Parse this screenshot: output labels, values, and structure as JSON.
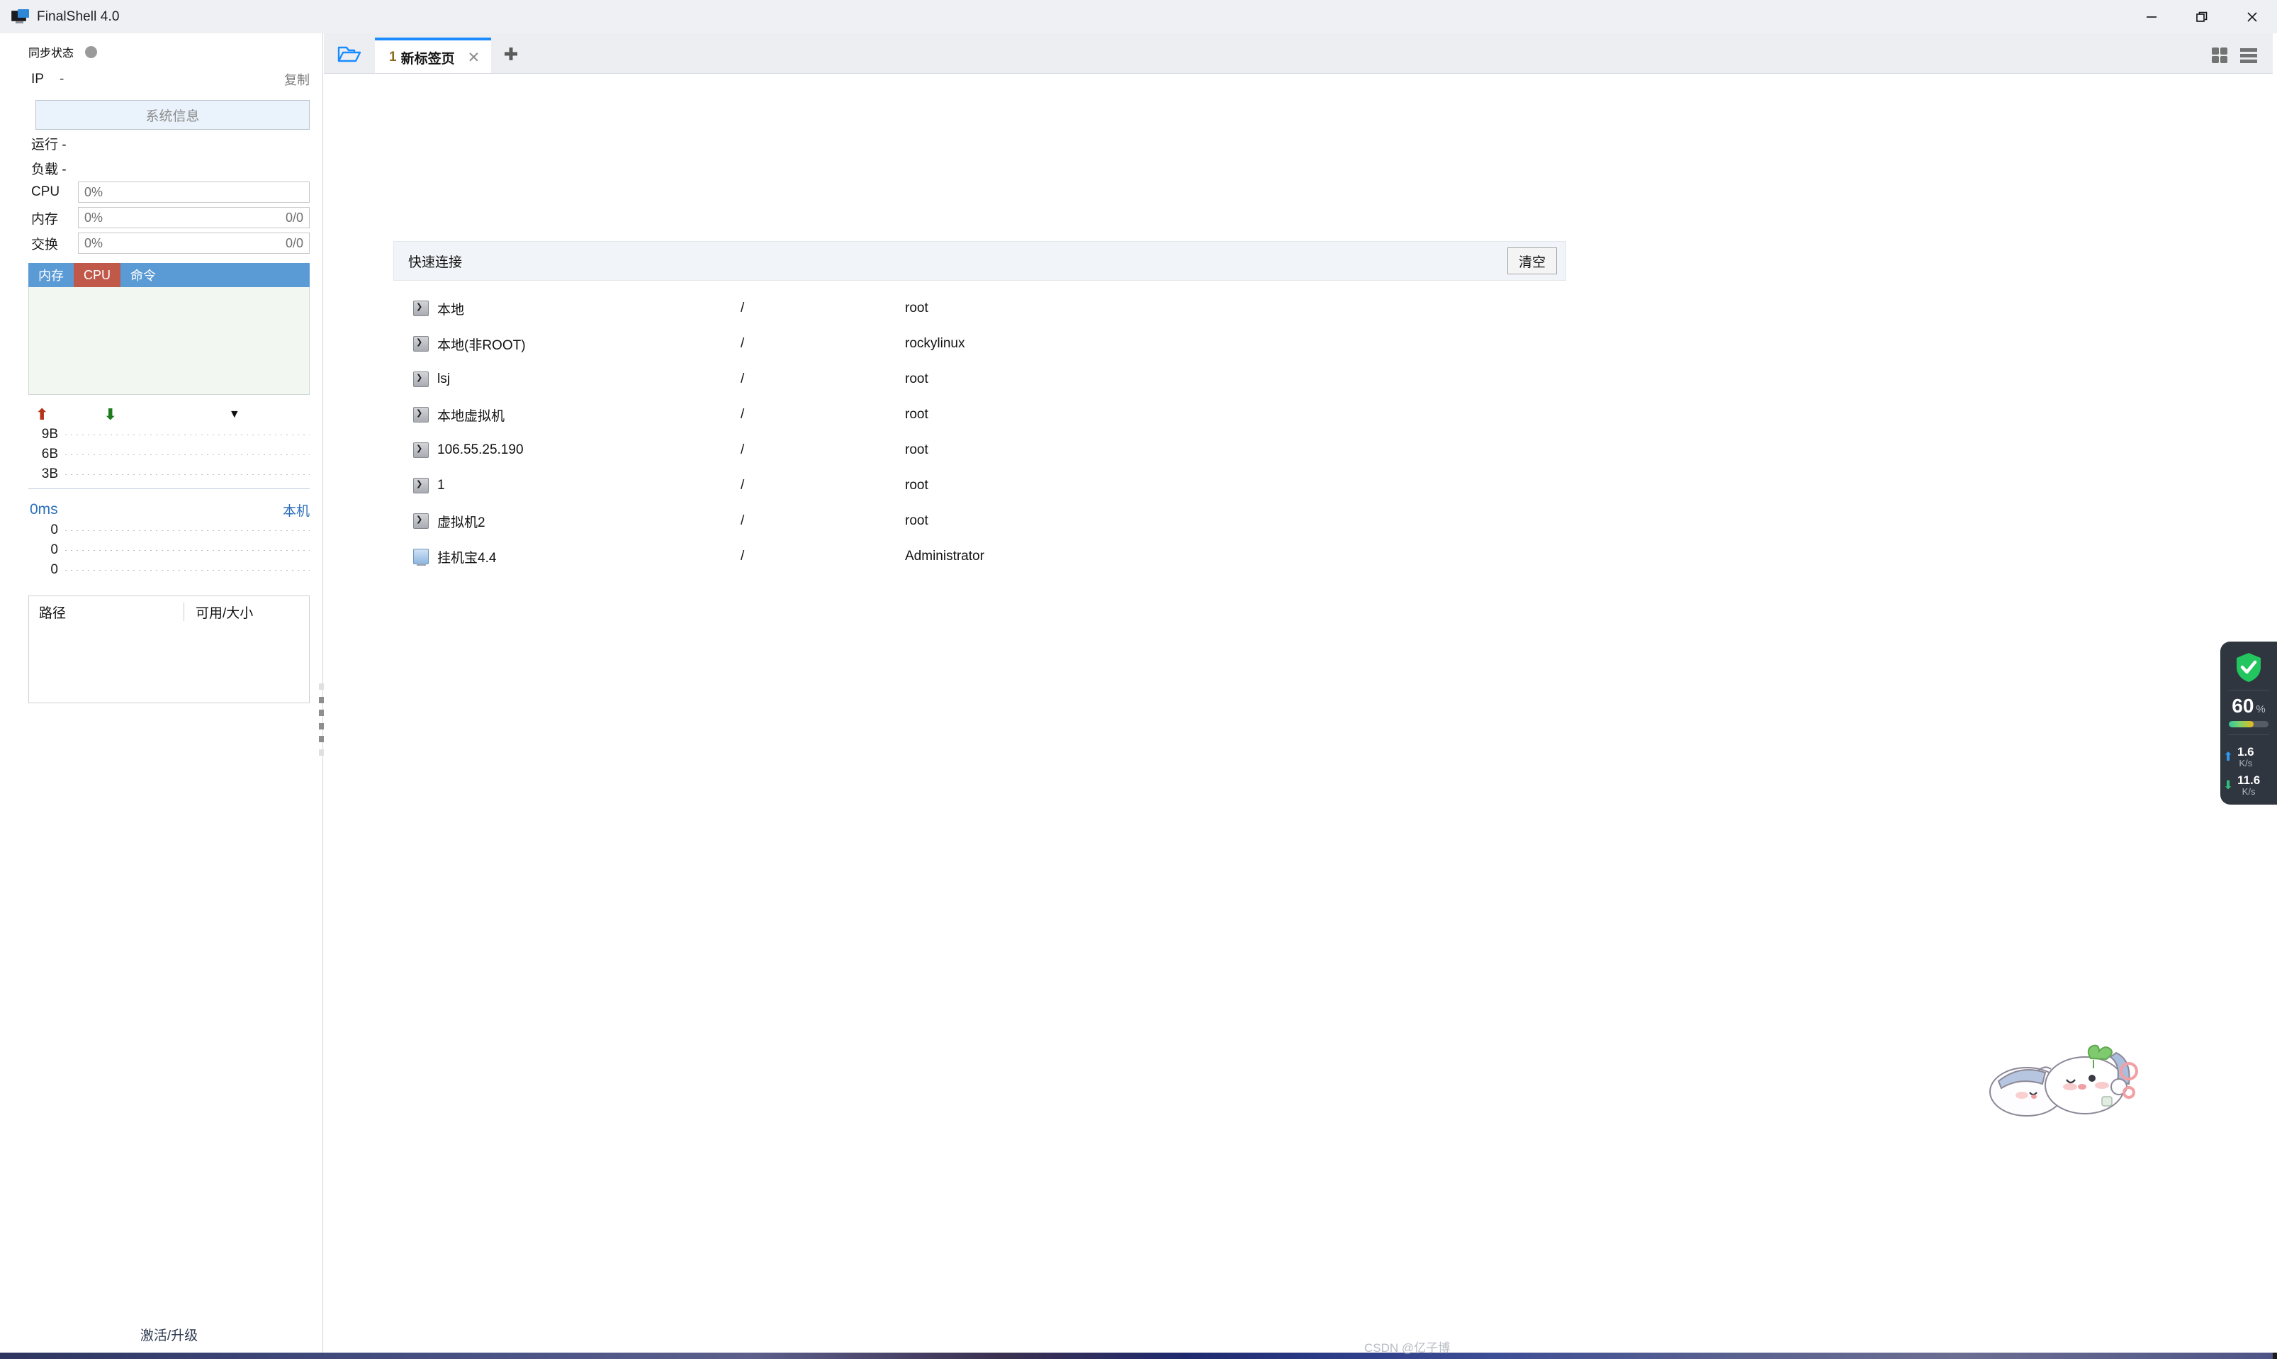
{
  "window": {
    "title": "FinalShell 4.0",
    "controls": {
      "minimize": "minimize-icon",
      "restore": "restore-icon",
      "close": "close-icon"
    }
  },
  "sidebar": {
    "sync": {
      "label": "同步状态",
      "status_dot_color": "#9a9a9a"
    },
    "ip": {
      "key": "IP",
      "value": "-",
      "copy_label": "复制"
    },
    "sysinfo_button": "系统信息",
    "uptime": {
      "key": "运行",
      "value": "-"
    },
    "load": {
      "key": "负载",
      "value": "-"
    },
    "meters": [
      {
        "key": "CPU",
        "percent": "0%",
        "detail": ""
      },
      {
        "key": "内存",
        "percent": "0%",
        "detail": "0/0"
      },
      {
        "key": "交换",
        "percent": "0%",
        "detail": "0/0"
      }
    ],
    "process_tabs": [
      {
        "label": "内存",
        "active": false
      },
      {
        "label": "CPU",
        "active": true
      },
      {
        "label": "命令",
        "active": false
      }
    ],
    "network": {
      "upload_icon": "arrow-up-icon",
      "download_icon": "arrow-down-icon",
      "menu_icon": "chevron-down-icon",
      "y_labels": [
        "9B",
        "6B",
        "3B"
      ]
    },
    "ping": {
      "value": "0ms",
      "host": "本机",
      "y_labels": [
        "0",
        "0",
        "0"
      ]
    },
    "disk": {
      "columns": [
        "路径",
        "可用/大小"
      ],
      "rows": []
    },
    "activate_link": "激活/升级"
  },
  "main": {
    "open_icon": "open-folder-icon",
    "tabs": [
      {
        "number": "1",
        "label": "新标签页",
        "close_icon": "close-icon",
        "active": true
      }
    ],
    "new_tab_icon": "plus-icon",
    "toolbar_right": [
      "grid-view-icon",
      "menu-icon"
    ],
    "quick_connect": {
      "title": "快速连接",
      "clear_button": "清空",
      "entries": [
        {
          "icon": "terminal-icon",
          "name": "本地",
          "path": "/",
          "user": "root"
        },
        {
          "icon": "terminal-icon",
          "name": "本地(非ROOT)",
          "path": "/",
          "user": "rockylinux"
        },
        {
          "icon": "terminal-icon",
          "name": "lsj",
          "path": "/",
          "user": "root"
        },
        {
          "icon": "terminal-icon",
          "name": "本地虚拟机",
          "path": "/",
          "user": "root"
        },
        {
          "icon": "terminal-icon",
          "name": "106.55.25.190",
          "path": "/",
          "user": "root"
        },
        {
          "icon": "terminal-icon",
          "name": "1",
          "path": "/",
          "user": "root"
        },
        {
          "icon": "terminal-icon",
          "name": "虚拟机2",
          "path": "/",
          "user": "root"
        },
        {
          "icon": "windows-icon",
          "name": "挂机宝4.4",
          "path": "/",
          "user": "Administrator"
        }
      ]
    }
  },
  "float_widget": {
    "shield_icon": "shield-check-icon",
    "percent_value": "60",
    "percent_sign": "%",
    "bar_fill_percent": 62,
    "upload": {
      "icon": "arrow-up-icon",
      "value": "1.6",
      "unit": "K/s"
    },
    "download": {
      "icon": "arrow-down-icon",
      "value": "11.6",
      "unit": "K/s"
    },
    "colors": {
      "background": "#2f3640",
      "shield": "#22c55e",
      "upload_arrow": "#2f9bf0",
      "download_arrow": "#2fc07a"
    }
  },
  "desktop_pet": {
    "name": "desktop-pet-mascot"
  },
  "watermark": {
    "text": "CSDN @亿子博"
  },
  "colors": {
    "titlebar_bg": "#eef0f4",
    "tab_accent": "#1a8cff",
    "proc_tab_bg": "#5b9bd5",
    "proc_tab_active_bg": "#c0594a",
    "link": "#2c6fba"
  }
}
